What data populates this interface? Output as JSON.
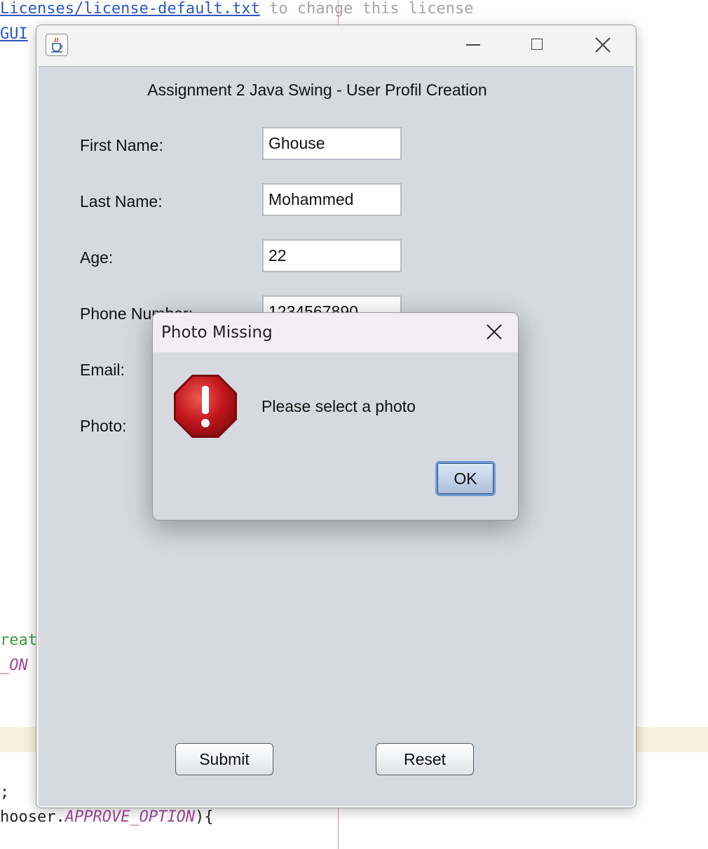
{
  "editor": {
    "line1_link": "Licenses/license-default.txt",
    "line1_rest": " to change this license",
    "line2_link": "GUI",
    "line3": "reat",
    "line4": "_ON",
    "line5": ";",
    "line6_a": "hooser.",
    "line6_b": "APPROVE_OPTION",
    "line6_c": "){"
  },
  "window": {
    "icon": "java-cup-icon",
    "controls": {
      "minimize": "minimize-icon",
      "maximize": "maximize-icon",
      "close": "close-icon"
    },
    "form_title": "Assignment 2 Java Swing - User Profil Creation",
    "fields": [
      {
        "label": "First Name:",
        "value": "Ghouse"
      },
      {
        "label": "Last Name:",
        "value": "Mohammed"
      },
      {
        "label": "Age:",
        "value": "22"
      },
      {
        "label": "Phone Number:",
        "value": "1234567890"
      },
      {
        "label": "Email:",
        "value": ""
      },
      {
        "label": "Photo:",
        "value": ""
      }
    ],
    "submit_label": "Submit",
    "reset_label": "Reset"
  },
  "dialog": {
    "title": "Photo Missing",
    "message": "Please select a photo",
    "ok_label": "OK",
    "icon": "error-stop-icon",
    "close_icon": "close-icon"
  },
  "colors": {
    "content_bg": "#d6d9e0",
    "error_red": "#c0161c",
    "ok_border": "#6f9ad0"
  }
}
